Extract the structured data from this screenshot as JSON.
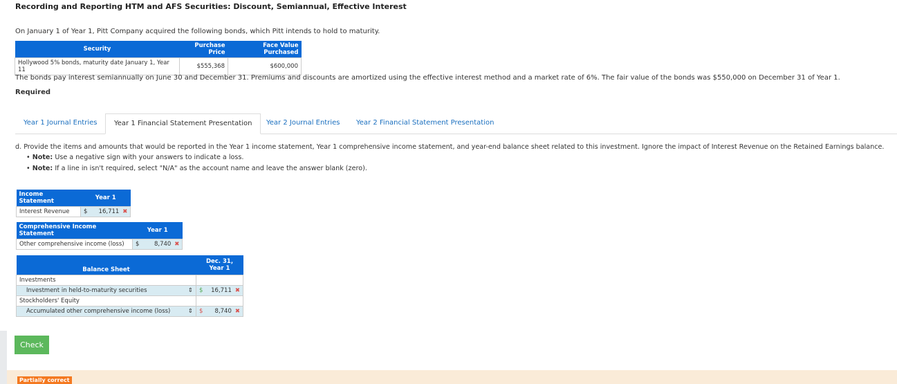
{
  "title": "Recording and Reporting HTM and AFS Securities: Discount, Semiannual, Effective Interest",
  "intro": "On January 1 of Year 1, Pitt Company acquired the following bonds, which Pitt intends to hold to maturity.",
  "securities": {
    "headers": [
      "Security",
      "Purchase Price",
      "Face Value Purchased"
    ],
    "row": [
      "Hollywood 5% bonds, maturity date January 1, Year 11",
      "$555,368",
      "$600,000"
    ]
  },
  "paragraph": "The bonds pay interest semiannually on June 30 and December 31. Premiums and discounts are amortized using the effective interest method and a market rate of 6%. The fair value of the bonds was $550,000 on December 31 of Year 1.",
  "required": "Required",
  "tabs": [
    "Year 1 Journal Entries",
    "Year 1 Financial Statement Presentation",
    "Year 2 Journal Entries",
    "Year 2 Financial Statement Presentation"
  ],
  "instruction": "d. Provide the items and amounts that would be reported in the Year 1 income statement, Year 1 comprehensive income statement, and year-end balance sheet related to this investment. Ignore the impact of Interest Revenue on the Retained Earnings balance.",
  "notes": [
    {
      "label": "Note:",
      "text": " Use a negative sign with your answers to indicate a loss."
    },
    {
      "label": "Note:",
      "text": " If a line in isn't required, select \"N/A\" as the account name and leave the answer blank (zero)."
    }
  ],
  "income": {
    "header": "Income Statement",
    "col": "Year 1",
    "label": "Interest Revenue",
    "cur": "$",
    "value": "16,711"
  },
  "comprehensive": {
    "header": "Comprehensive Income Statement",
    "col": "Year 1",
    "label": "Other comprehensive income (loss)",
    "cur": "$",
    "value": "8,740"
  },
  "balance": {
    "header": "Balance Sheet",
    "col": "Dec. 31, Year 1",
    "section1": "Investments",
    "item1": "Investment in held-to-maturity securities",
    "cur1": "$",
    "value1": "16,711",
    "section2": "Stockholders' Equity",
    "item2": "Accumulated other comprehensive income (loss)",
    "cur2": "$",
    "value2": "8,740"
  },
  "check": "Check",
  "status": "Partially correct",
  "wrong_mark": "✖"
}
